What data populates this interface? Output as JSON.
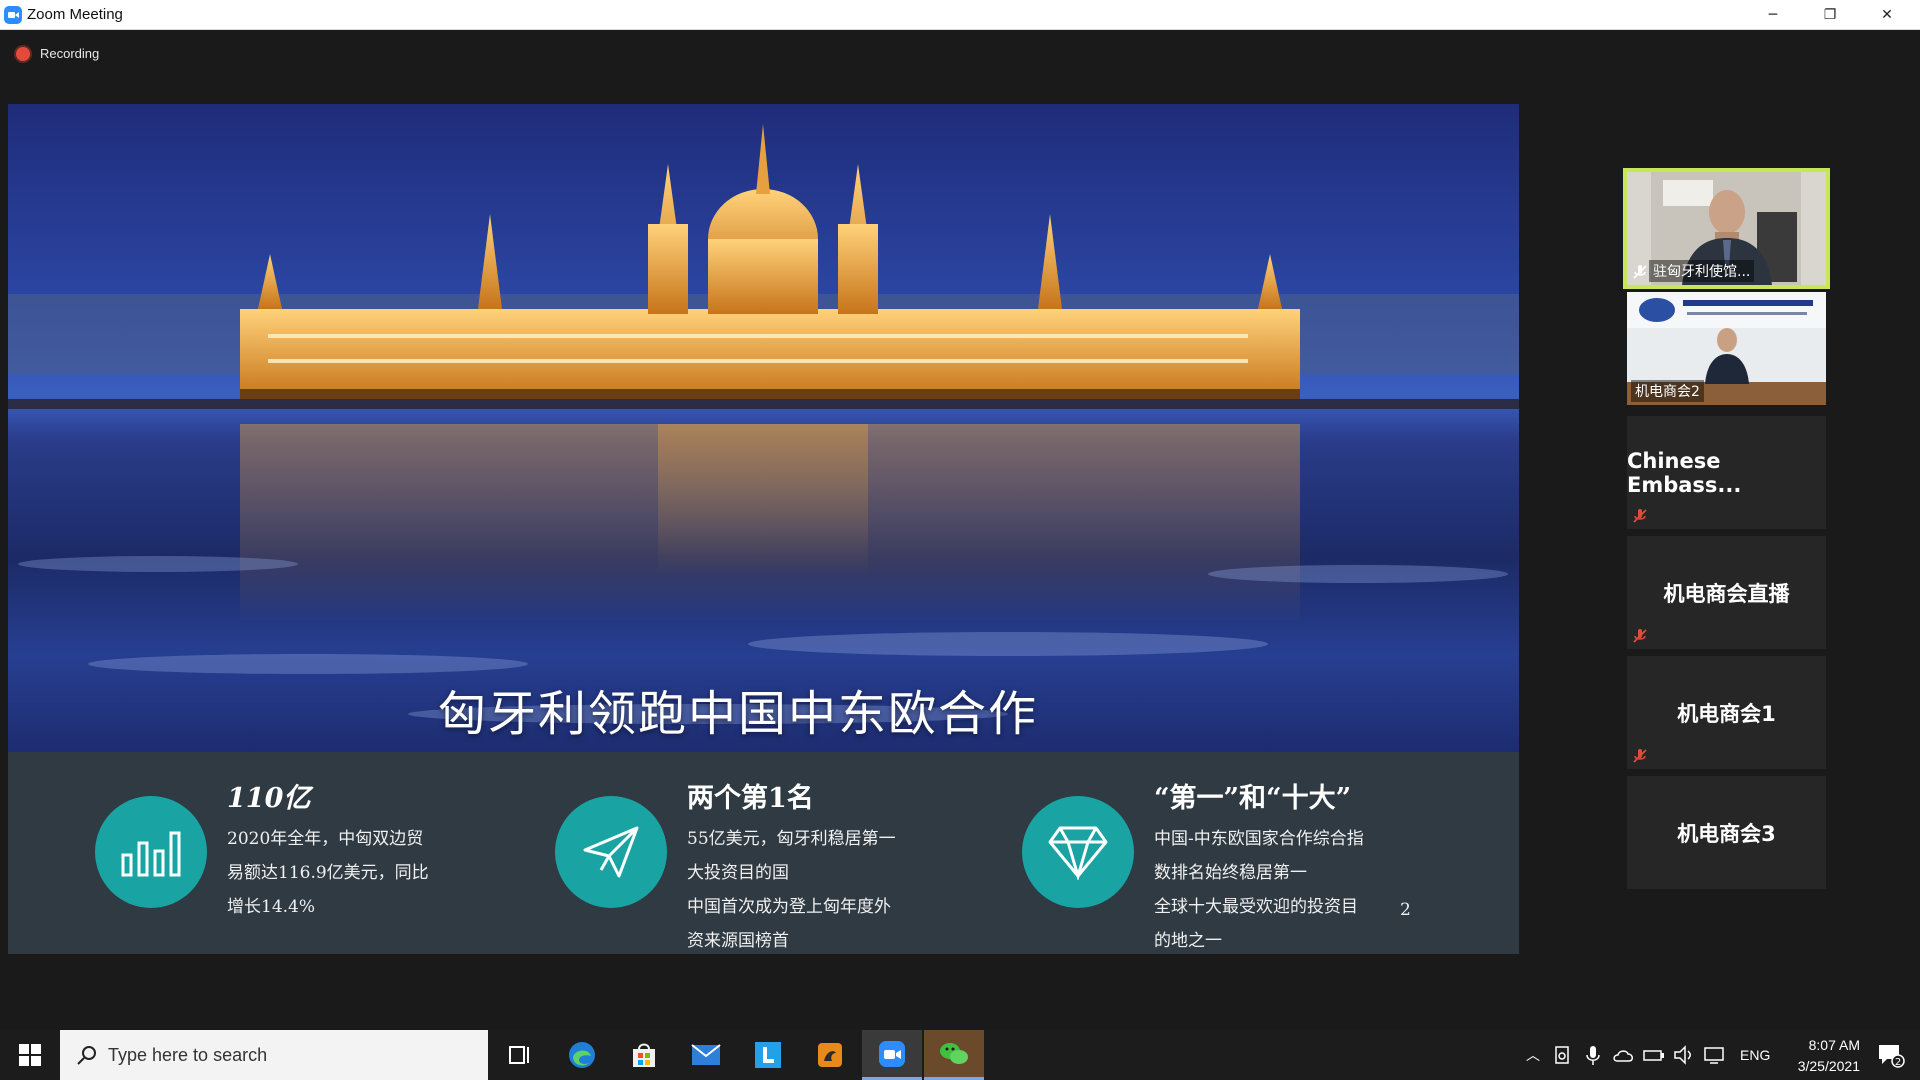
{
  "window": {
    "title": "Zoom Meeting",
    "controls": {
      "minimize": "─",
      "restore": "❐",
      "close": "✕"
    }
  },
  "meeting": {
    "recording_label": "Recording"
  },
  "slide": {
    "title": "匈牙利领跑中国中东欧合作",
    "stats": [
      {
        "heading": "110亿",
        "lines": [
          "2020年全年，中匈双边贸",
          "易额达116.9亿美元，同比",
          "增长14.4%"
        ],
        "icon": "bar-chart-icon"
      },
      {
        "heading": "两个第1名",
        "lines": [
          "55亿美元，匈牙利稳居第一",
          "大投资目的国",
          "中国首次成为登上匈年度外",
          "资来源国榜首"
        ],
        "icon": "paper-plane-icon"
      },
      {
        "heading": "“第一”和“十大”",
        "lines": [
          "中国-中东欧国家合作综合指",
          "数排名始终稳居第一",
          "全球十大最受欢迎的投资目",
          "的地之一"
        ],
        "icon": "diamond-icon"
      }
    ],
    "page_number": "2"
  },
  "gallery": [
    {
      "name": "驻匈牙利使馆...",
      "type": "video",
      "active": true
    },
    {
      "name": "机电商会2",
      "type": "video",
      "active": false
    },
    {
      "name": "Chinese  Embass...",
      "type": "name",
      "muted": true
    },
    {
      "name": "机电商会直播",
      "type": "name",
      "muted": true
    },
    {
      "name": "机电商会1",
      "type": "name",
      "muted": true
    },
    {
      "name": "机电商会3",
      "type": "name",
      "muted": false
    }
  ],
  "taskbar": {
    "search_placeholder": "Type here to search",
    "apps": [
      "task-view-icon",
      "edge-icon",
      "store-icon",
      "mail-icon",
      "l-app-icon",
      "slides-app-icon",
      "zoom-icon",
      "wechat-icon"
    ],
    "language": "ENG",
    "time": "8:07 AM",
    "date": "3/25/2021",
    "notification_count": "2"
  },
  "colors": {
    "accent_teal": "#1aa3a3",
    "active_speaker_border": "#c8e65a",
    "recording_red": "#e24b3b"
  }
}
